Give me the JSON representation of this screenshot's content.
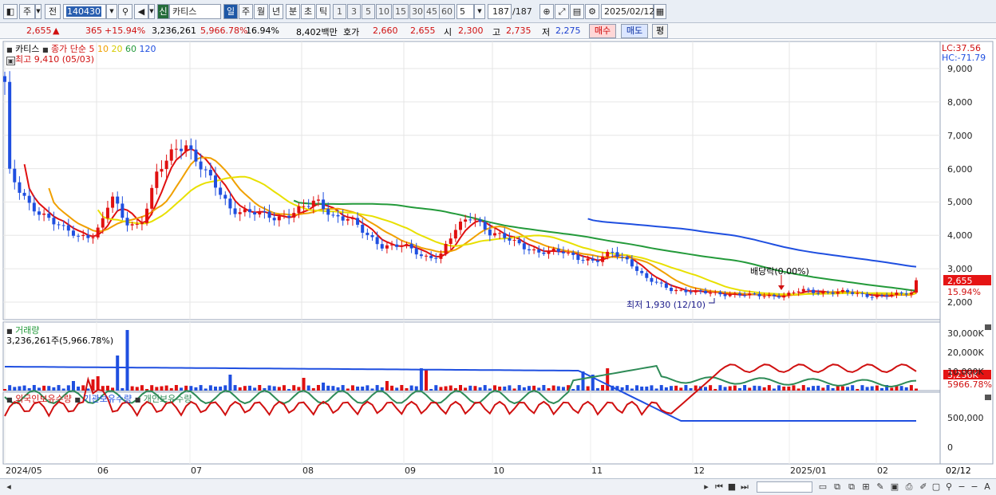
{
  "toolbar": {
    "market_label": "주",
    "prev_label": "전",
    "code": "140430",
    "stock_tag": "신",
    "stock_name": "카티스",
    "periods": [
      "일",
      "주",
      "월",
      "년",
      "분",
      "초",
      "틱"
    ],
    "active_period": "일",
    "tick_numbers": [
      "1",
      "3",
      "5",
      "10",
      "15",
      "30",
      "45",
      "60"
    ],
    "tick_count": "5",
    "count": "187",
    "count_total": "/187",
    "date": "2025/02/12"
  },
  "quote": {
    "price": "2,655",
    "change_arrow": "▲",
    "change": "365",
    "change_pct": "+15.94%",
    "volume": "3,236,261",
    "volume_ratio": "5,966.78%",
    "turnover": "16.94%",
    "amount": "8,402백만",
    "bid_label": "호가",
    "ask_price": "2,660",
    "bid_price": "2,655",
    "open_label": "시",
    "open": "2,300",
    "high_label": "고",
    "high": "2,735",
    "low_label": "저",
    "low": "2,275",
    "buy_label": "매수",
    "sell_label": "매도",
    "avg_label": "평"
  },
  "price_panel": {
    "name": "카티스",
    "legend_prefix": "종가 단순",
    "ma_periods": [
      "5",
      "10",
      "20",
      "60",
      "120"
    ],
    "ma_colors": [
      "#e01010",
      "#f0a000",
      "#e8e000",
      "#239a3a",
      "#1f4fe0"
    ],
    "high_note": "최고 9,410 (05/03)",
    "low_note": "최저 1,930 (12/10)",
    "dividend_note": "배당락(0.00%)",
    "lc": "LC:37.56",
    "hc": "HC:-71.79",
    "last_price_tag": "2,655",
    "last_change_tag": "15.94%",
    "y_ticks": [
      "9,000",
      "8,000",
      "7,000",
      "6,000",
      "5,000",
      "4,000",
      "3,000",
      "2,000"
    ]
  },
  "volume_panel": {
    "title": "거래량",
    "last_text": "3,236,261주(5,966.78%)",
    "y_ticks": [
      "30,000K",
      "20,000K",
      "10,000K"
    ],
    "last_tag": "3,236K",
    "last_pct_tag": "5966.78%"
  },
  "holdings_panel": {
    "legend": [
      "외국인보유수량",
      "기관보유수량",
      "개인보유수량"
    ],
    "legend_colors": [
      "#d01010",
      "#1f4fe0",
      "#2e8b57"
    ],
    "y_ticks": [
      "500,000",
      "0"
    ]
  },
  "x_axis": {
    "labels": [
      "2024/05",
      "06",
      "07",
      "08",
      "09",
      "10",
      "11",
      "12",
      "2025/01",
      "02"
    ],
    "right_label": "02/12"
  },
  "chart_data": {
    "type": "candlestick",
    "title": "카티스",
    "y_range": [
      1800,
      9410
    ],
    "candles_anchor": [
      {
        "date": "2024/05/03",
        "high": 9410
      },
      {
        "date": "2024/12/10",
        "low": 1930
      },
      {
        "date": "2025/02/12",
        "open": 2300,
        "high": 2735,
        "low": 2275,
        "close": 2655
      }
    ],
    "volume_last": 3236261
  }
}
